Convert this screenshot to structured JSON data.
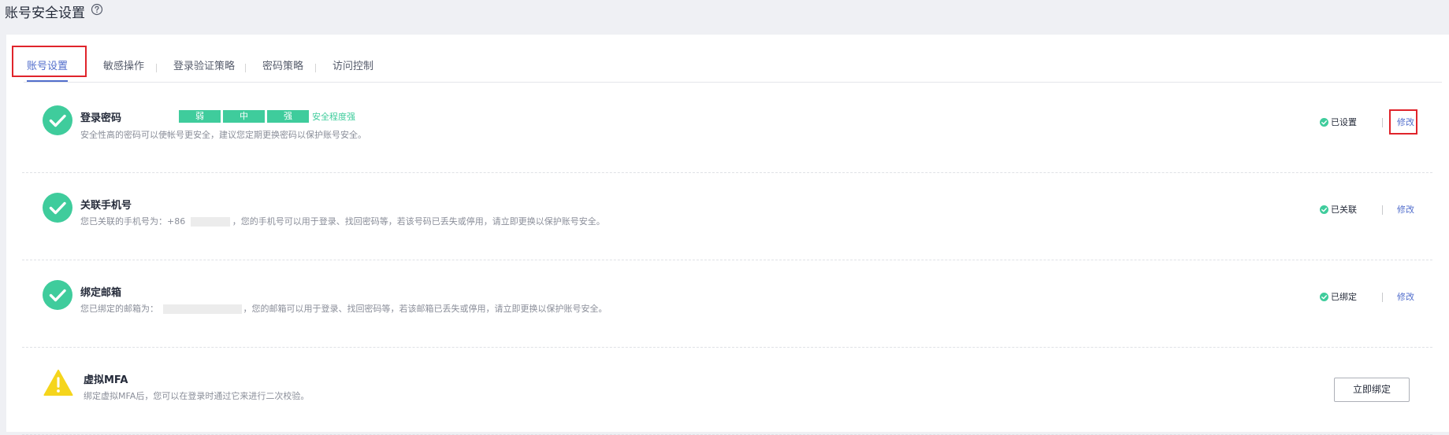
{
  "page": {
    "title": "账号安全设置"
  },
  "tabs": [
    {
      "label": "账号设置",
      "active": true
    },
    {
      "label": "敏感操作",
      "active": false
    },
    {
      "label": "登录验证策略",
      "active": false
    },
    {
      "label": "密码策略",
      "active": false
    },
    {
      "label": "访问控制",
      "active": false
    }
  ],
  "rows": {
    "password": {
      "title": "登录密码",
      "strength": {
        "levels": [
          "弱",
          "中",
          "强"
        ],
        "label": "安全程度强"
      },
      "description": "安全性高的密码可以使帐号更安全，建议您定期更换密码以保护账号安全。",
      "status": "已设置",
      "action": "修改"
    },
    "phone": {
      "title": "关联手机号",
      "desc_prefix": "您已关联的手机号为：+86",
      "desc_suffix": "，您的手机号可以用于登录、找回密码等，若该号码已丢失或停用，请立即更换以保护账号安全。",
      "status": "已关联",
      "action": "修改"
    },
    "email": {
      "title": "绑定邮箱",
      "desc_prefix": "您已绑定的邮箱为：",
      "desc_suffix": "，您的邮箱可以用于登录、找回密码等，若该邮箱已丢失或停用，请立即更换以保护账号安全。",
      "status": "已绑定",
      "action": "修改"
    },
    "mfa": {
      "title": "虚拟MFA",
      "description": "绑定虚拟MFA后，您可以在登录时通过它来进行二次校验。",
      "action": "立即绑定"
    }
  },
  "colors": {
    "accent": "#526ecc",
    "success": "#3fcc9c",
    "warning": "#f5d51c",
    "highlight": "#e0242b"
  },
  "icons": {
    "help": "question-circle-icon",
    "success": "check-circle-icon",
    "warning": "warning-triangle-icon"
  }
}
